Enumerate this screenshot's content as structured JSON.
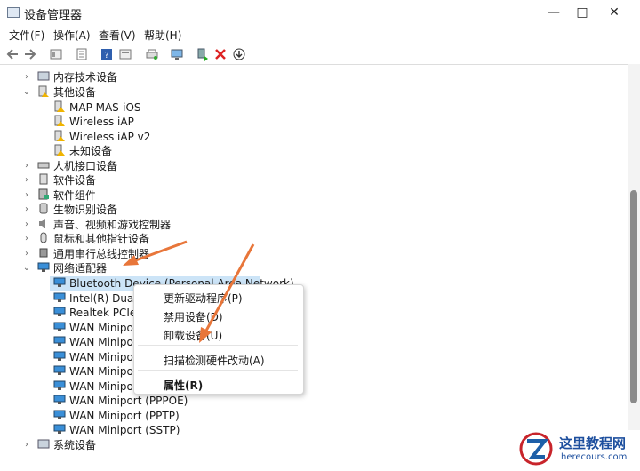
{
  "window": {
    "title": "设备管理器",
    "controls": [
      "—",
      "□",
      "✕"
    ]
  },
  "menu": [
    "文件(F)",
    "操作(A)",
    "查看(V)",
    "帮助(H)"
  ],
  "tree": [
    {
      "label": "内存技术设备",
      "expanded": false
    },
    {
      "label": "其他设备",
      "expanded": true
    },
    {
      "label": "MAP MAS-iOS",
      "child": true
    },
    {
      "label": "Wireless iAP",
      "child": true
    },
    {
      "label": "Wireless iAP v2",
      "child": true
    },
    {
      "label": "未知设备",
      "child": true
    },
    {
      "label": "人机接口设备",
      "expanded": false
    },
    {
      "label": "软件设备",
      "expanded": false
    },
    {
      "label": "软件组件",
      "expanded": false
    },
    {
      "label": "生物识别设备",
      "expanded": false
    },
    {
      "label": "声音、视频和游戏控制器",
      "expanded": false
    },
    {
      "label": "鼠标和其他指针设备",
      "expanded": false
    },
    {
      "label": "通用串行总线控制器",
      "expanded": false
    },
    {
      "label": "网络适配器",
      "expanded": true
    },
    {
      "label": "Bluetooth Device (Personal Area Network)",
      "child": true,
      "selected": true
    },
    {
      "label": "Intel(R) Dual B",
      "child": true
    },
    {
      "label": "Realtek PCIe G",
      "child": true
    },
    {
      "label": "WAN Miniport",
      "child": true
    },
    {
      "label": "WAN Miniport",
      "child": true
    },
    {
      "label": "WAN Miniport",
      "child": true
    },
    {
      "label": "WAN Miniport",
      "child": true
    },
    {
      "label": "WAN Miniport",
      "child": true
    },
    {
      "label": "WAN Miniport (PPPOE)",
      "child": true
    },
    {
      "label": "WAN Miniport (PPTP)",
      "child": true
    },
    {
      "label": "WAN Miniport (SSTP)",
      "child": true
    },
    {
      "label": "系统设备",
      "expanded": false
    }
  ],
  "context_menu": [
    "更新驱动程序(P)",
    "禁用设备(D)",
    "卸载设备(U)",
    "扫描检测硬件改动(A)",
    "属性(R)"
  ],
  "watermark": {
    "name": "这里教程网",
    "url": "herecours.com"
  },
  "colors": {
    "arrow": "#e8763a",
    "selection": "#cce4f7",
    "network_icon": "#3a8fd8"
  }
}
